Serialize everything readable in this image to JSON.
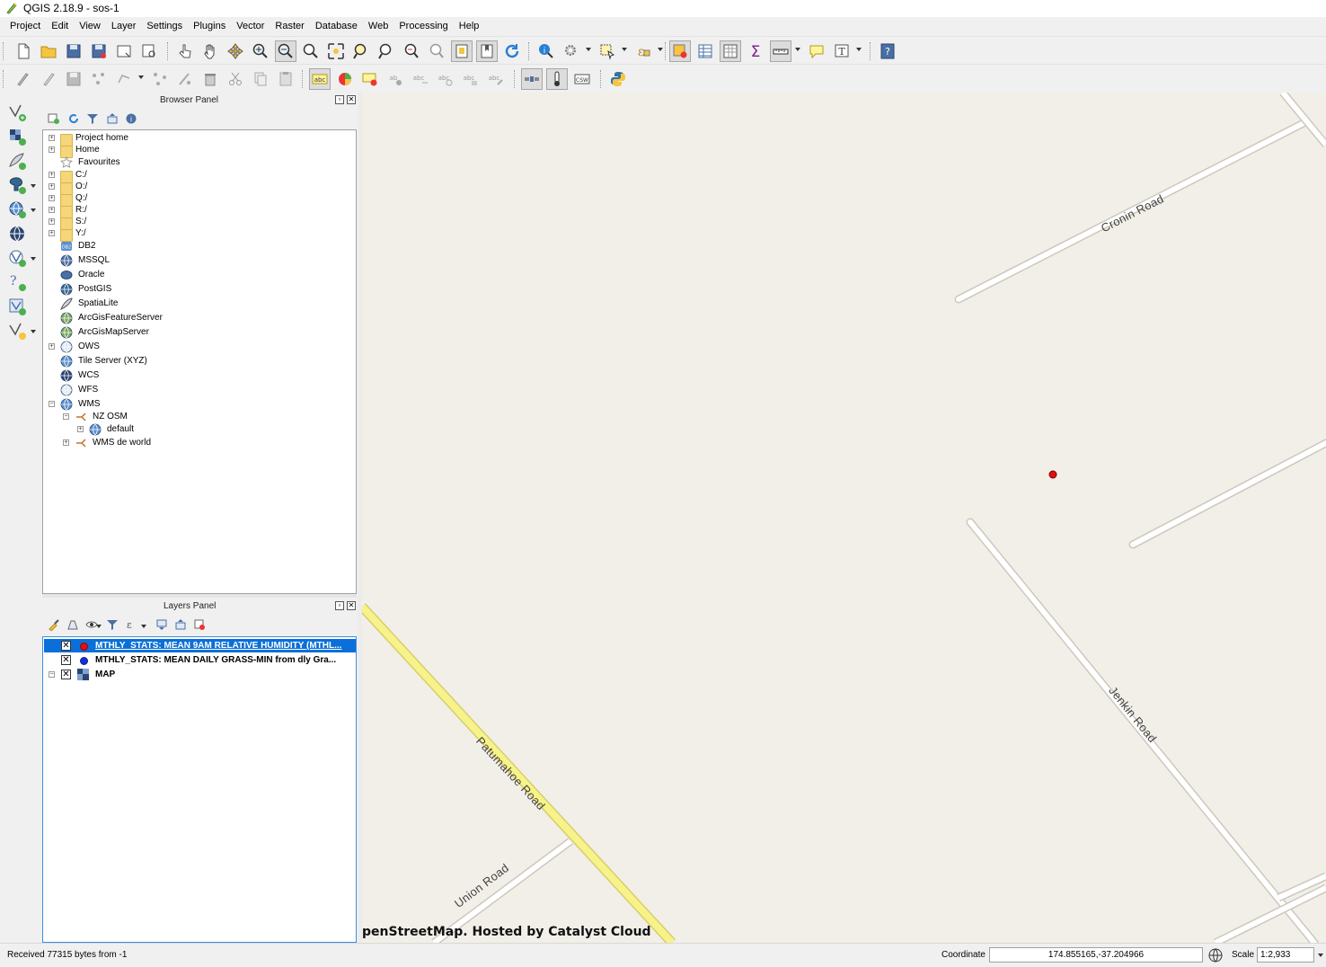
{
  "window": {
    "title": "QGIS 2.18.9 - sos-1"
  },
  "menu": [
    "Project",
    "Edit",
    "View",
    "Layer",
    "Settings",
    "Plugins",
    "Vector",
    "Raster",
    "Database",
    "Web",
    "Processing",
    "Help"
  ],
  "browser_panel": {
    "title": "Browser Panel",
    "items": [
      {
        "label": "Project home",
        "icon": "folder-icon",
        "expandable": true
      },
      {
        "label": "Home",
        "icon": "folder-icon",
        "expandable": true
      },
      {
        "label": "Favourites",
        "icon": "star-icon",
        "expandable": false
      },
      {
        "label": "C:/",
        "icon": "folder-icon",
        "expandable": true
      },
      {
        "label": "O:/",
        "icon": "folder-icon",
        "expandable": true
      },
      {
        "label": "Q:/",
        "icon": "folder-icon",
        "expandable": true
      },
      {
        "label": "R:/",
        "icon": "folder-icon",
        "expandable": true
      },
      {
        "label": "S:/",
        "icon": "folder-icon",
        "expandable": true
      },
      {
        "label": "Y:/",
        "icon": "folder-icon",
        "expandable": true
      },
      {
        "label": "DB2",
        "icon": "db2-icon",
        "expandable": false
      },
      {
        "label": "MSSQL",
        "icon": "mssql-icon",
        "expandable": false
      },
      {
        "label": "Oracle",
        "icon": "oracle-icon",
        "expandable": false
      },
      {
        "label": "PostGIS",
        "icon": "postgis-icon",
        "expandable": false
      },
      {
        "label": "SpatiaLite",
        "icon": "spatialite-icon",
        "expandable": false
      },
      {
        "label": "ArcGisFeatureServer",
        "icon": "arcgis-feature-icon",
        "expandable": false
      },
      {
        "label": "ArcGisMapServer",
        "icon": "arcgis-map-icon",
        "expandable": false
      },
      {
        "label": "OWS",
        "icon": "ows-icon",
        "expandable": true
      },
      {
        "label": "Tile Server (XYZ)",
        "icon": "xyz-icon",
        "expandable": false
      },
      {
        "label": "WCS",
        "icon": "wcs-icon",
        "expandable": false
      },
      {
        "label": "WFS",
        "icon": "wfs-icon",
        "expandable": false
      },
      {
        "label": "WMS",
        "icon": "wms-icon",
        "expandable": true
      },
      {
        "label": "NZ OSM",
        "icon": "connection-icon",
        "expandable": true
      },
      {
        "label": "default",
        "icon": "wms-layer-icon",
        "expandable": true
      },
      {
        "label": "WMS de world",
        "icon": "connection-icon",
        "expandable": true
      }
    ]
  },
  "layers_panel": {
    "title": "Layers Panel",
    "layers": [
      {
        "label": "MTHLY_STATS: MEAN 9AM RELATIVE HUMIDITY (MTHL...",
        "color": "#e01010",
        "selected": true
      },
      {
        "label": "MTHLY_STATS: MEAN DAILY GRASS-MIN from dly Gra...",
        "color": "#1030e0",
        "selected": false
      },
      {
        "label": "MAP",
        "color": "",
        "selected": false
      }
    ]
  },
  "map": {
    "roads": [
      "Cronin Road",
      "Jenkin Road",
      "Patumahoe Road",
      "Union Road"
    ],
    "attribution": "penStreetMap. Hosted by Catalyst Cloud"
  },
  "status": {
    "message": "Received 77315 bytes from -1",
    "coordinate_label": "Coordinate",
    "coordinate_value": "174.855165,-37.204966",
    "scale_label": "Scale",
    "scale_value": "1:2,933"
  },
  "colors": {
    "accent": "#0a6fd8",
    "map_bg": "#f2efe9",
    "main_road": "#f7f28a"
  }
}
